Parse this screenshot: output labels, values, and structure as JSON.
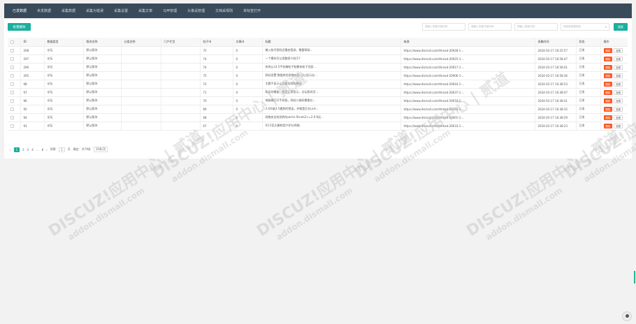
{
  "nav": {
    "tabs": [
      "已发数据",
      "未发数据",
      "采集数据",
      "采集为错误",
      "采集设置",
      "采集文章",
      "马甲管理",
      "头像设管理",
      "文档采规则",
      "单标签打开"
    ],
    "active_index": 0
  },
  "toolbar": {
    "batch_delete": "批量删除",
    "start_time_placeholder": "请输入采集开始时间",
    "end_time_placeholder": "请输入采集开始时间",
    "content_placeholder": "请输入搜索内容",
    "type_select": "请选择数据类型",
    "search_button": "搜索"
  },
  "table": {
    "headers": [
      "",
      "ID",
      "数据类型",
      "版块名称",
      "分类名称",
      "门户栏目",
      "帖子id",
      "文章id",
      "标题",
      "来源",
      "采集时间",
      "状态",
      "操作"
    ],
    "action_delete": "删除",
    "action_view": "查看",
    "rows": [
      {
        "id": "298",
        "type": "论坛",
        "forum": "默认版块",
        "category": "",
        "portal": "",
        "tid": "75",
        "aid": "0",
        "title": "输入账号密码还需启登录，需要帮助...",
        "source": "https://www.dismall.com/thread-20928-1-...",
        "time": "2024-03-17 16:25:57",
        "status": "已发"
      },
      {
        "id": "297",
        "type": "论坛",
        "forum": "默认版块",
        "category": "",
        "portal": "",
        "tid": "74",
        "aid": "0",
        "title": "一个模块可以用触多少帖子?",
        "source": "https://www.dismall.com/thread-20925-1-...",
        "time": "2024-03-17 16:58:47",
        "status": "已发"
      },
      {
        "id": "296",
        "type": "论坛",
        "forum": "默认版块",
        "category": "",
        "portal": "",
        "tid": "74",
        "aid": "0",
        "title": "如何让x3.5手机端帖子帖都有帖子页面...",
        "source": "https://www.dismall.com/thread-20917-1-...",
        "time": "2024-03-17 16:58:41",
        "status": "已发"
      },
      {
        "id": "295",
        "type": "论坛",
        "forum": "默认版块",
        "category": "",
        "portal": "",
        "tid": "75",
        "aid": "0",
        "title": "网站设置 数据库信息都对应 可以显示自...",
        "source": "https://www.dismall.com/thread-20906-1-...",
        "time": "2024-03-17 16:58:36",
        "status": "已发"
      },
      {
        "id": "98",
        "type": "论坛",
        "forum": "默认版块",
        "category": "",
        "portal": "",
        "tid": "72",
        "aid": "0",
        "title": "主题不显示以及真实帖的原因",
        "source": "https://www.dismall.com/thread-20644-1-...",
        "time": "2024-03-17 16:38:53",
        "status": "已发"
      },
      {
        "id": "97",
        "type": "论坛",
        "forum": "默认版块",
        "category": "",
        "portal": "",
        "tid": "71",
        "aid": "0",
        "title": "购买的模板，首页正常显示，论坛版块页...",
        "source": "https://www.dismall.com/thread-20637-1-...",
        "time": "2024-03-17 16:38:47",
        "status": "已发"
      },
      {
        "id": "96",
        "type": "论坛",
        "forum": "默认版块",
        "category": "",
        "portal": "",
        "tid": "70",
        "aid": "0",
        "title": "电脑端打开手机版，网站二维码需要在...",
        "source": "https://www.dismall.com/thread-20674-1-...",
        "time": "2024-03-17 16:38:41",
        "status": "已发"
      },
      {
        "id": "95",
        "type": "论坛",
        "forum": "默认版块",
        "category": "",
        "portal": "",
        "tid": "69",
        "aid": "0",
        "title": "3.4升级3.5遇到的错误，并随是后台ucd...",
        "source": "https://www.dismall.com/thread-20563-1-...",
        "time": "2024-03-17 16:38:35",
        "status": "已发"
      },
      {
        "id": "94",
        "type": "论坛",
        "forum": "默认版块",
        "category": "",
        "portal": "",
        "tid": "68",
        "aid": "0",
        "title": "网络安全检测到Apache Struts2<=2.0.9远...",
        "source": "https://www.dismall.com/thread-20601-1-...",
        "time": "2024-03-17 16:38:29",
        "status": "已发"
      },
      {
        "id": "93",
        "type": "论坛",
        "forum": "默认版块",
        "category": "",
        "portal": "",
        "tid": "67",
        "aid": "0",
        "title": "X3.5怎么删除用户积分明细",
        "source": "https://www.dismall.com/thread-20633-1-...",
        "time": "2024-03-17 16:38:23",
        "status": "已发"
      }
    ]
  },
  "pager": {
    "prev": "‹",
    "pages": [
      "1",
      "2",
      "3",
      "4"
    ],
    "ellipsis": "...",
    "last": "8",
    "next": "›",
    "goto_label": "到第",
    "goto_value": "1",
    "page_unit": "页",
    "confirm": "确定",
    "total": "共78条",
    "limit": "10条/页"
  },
  "watermark": {
    "line1": "DISCUZ!应用中心 | 贰道",
    "line2": "addon.dismall.com"
  }
}
